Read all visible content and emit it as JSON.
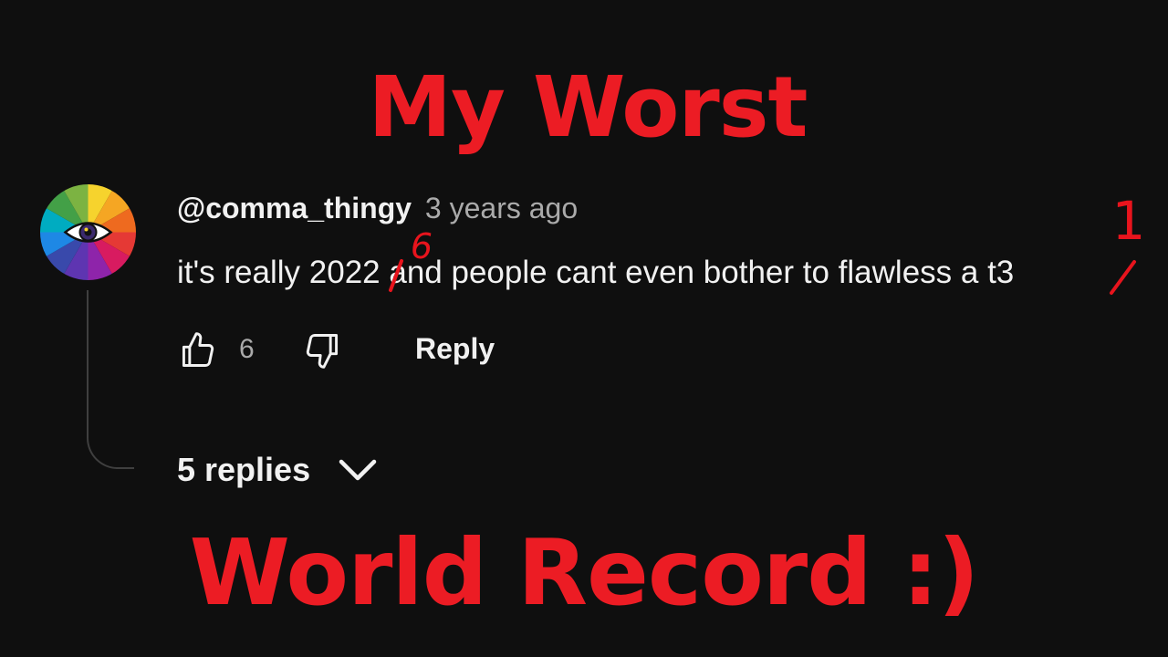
{
  "headline": {
    "top": "My Worst",
    "bottom": "World Record :)"
  },
  "comment": {
    "author": "@comma_thingy",
    "timestamp": "3 years ago",
    "text": "it's really 2022 and people cant even bother to flawless a t3",
    "likes": "6",
    "reply_label": "Reply",
    "replies_label": "5 replies",
    "annotations": [
      "6",
      "1"
    ]
  },
  "colors": {
    "background": "#0f0f0f",
    "headline": "#ec1c24",
    "annotation": "#e8141d",
    "primary_text": "#f1f1f1",
    "secondary_text": "#aaaaaa"
  },
  "icons": {
    "like": "thumbs-up-outline-icon",
    "dislike": "thumbs-down-outline-icon",
    "expand": "chevron-down-icon",
    "avatar": "rainbow-eye-avatar"
  }
}
